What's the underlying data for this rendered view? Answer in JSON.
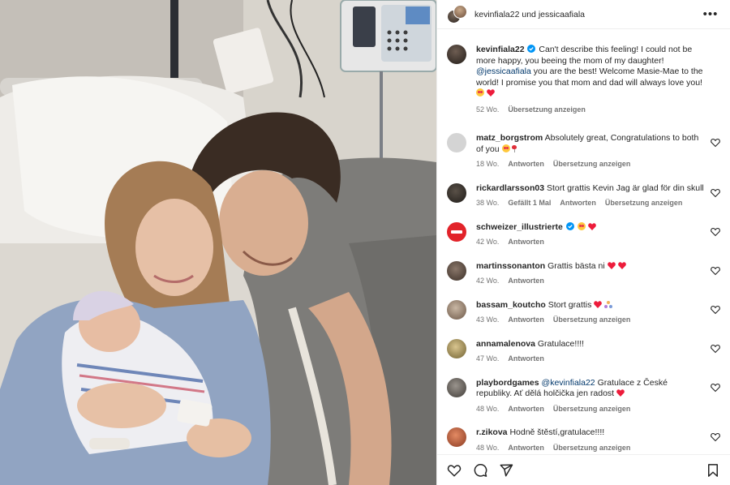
{
  "header": {
    "user1": "kevinfiala22",
    "connector": "und",
    "user2": "jessicaafiala"
  },
  "caption": {
    "username": "kevinfiala22",
    "text1": "Can't describe this feeling! I could not be more happy, you beeing the mom of my daughter!",
    "mention": "@jessicaafiala",
    "text2": "you are the best! Welcome Masie-Mae to the world! I promise you that mom and dad will always love you!",
    "age": "52 Wo.",
    "translate": "Übersetzung anzeigen"
  },
  "comments": [
    {
      "username": "matz_borgstrom",
      "text": "Absolutely great, Congratulations to both of you",
      "age": "18 Wo.",
      "likes": "",
      "reply": "Antworten",
      "translate": "Übersetzung anzeigen",
      "avatar": "#c9c9c9"
    },
    {
      "username": "rickardlarsson03",
      "text": "Stort grattis Kevin Jag är glad för din skull",
      "age": "38 Wo.",
      "likes": "Gefällt 1 Mal",
      "reply": "Antworten",
      "translate": "Übersetzung anzeigen",
      "avatar": "#3e3a36"
    },
    {
      "username": "schweizer_illustrierte",
      "text": "",
      "age": "42 Wo.",
      "likes": "",
      "reply": "Antworten",
      "translate": "",
      "avatar": "#e2232a"
    },
    {
      "username": "martinssonanton",
      "text": "Grattis bästa ni",
      "age": "42 Wo.",
      "likes": "",
      "reply": "Antworten",
      "translate": "",
      "avatar": "#5b4a3f"
    },
    {
      "username": "bassam_koutcho",
      "text": "Stort grattis",
      "age": "43 Wo.",
      "likes": "",
      "reply": "Antworten",
      "translate": "Übersetzung anzeigen",
      "avatar": "#a08d7b"
    },
    {
      "username": "annamalenova",
      "text": "Gratulace!!!!",
      "age": "47 Wo.",
      "likes": "",
      "reply": "Antworten",
      "translate": "",
      "avatar": "#8a7a52"
    },
    {
      "username": "playbordgames",
      "mention": "@kevinfiala22",
      "text": "Gratulace z České republiky. Ať dělá holčička jen radost",
      "age": "48 Wo.",
      "likes": "",
      "reply": "Antworten",
      "translate": "Übersetzung anzeigen",
      "avatar": "#6f6a64"
    },
    {
      "username": "r.zikova",
      "text": "Hodně štěstí,gratulace!!!!",
      "age": "48 Wo.",
      "likes": "",
      "reply": "Antworten",
      "translate": "Übersetzung anzeigen",
      "avatar": "#c0603f"
    }
  ],
  "icons": {
    "more": "more-options-icon",
    "like": "heart-icon",
    "comment": "comment-icon",
    "share": "share-icon",
    "save": "bookmark-icon",
    "verified": "verified-badge-icon"
  },
  "colors": {
    "verified": "#0095f6",
    "heart_emoji": "#ed1c3b",
    "mention": "#00376b",
    "meta": "#737373"
  }
}
